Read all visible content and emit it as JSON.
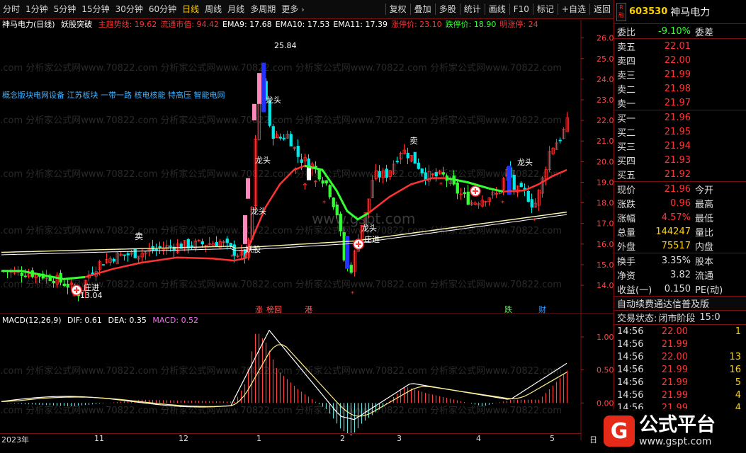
{
  "toolbar": {
    "left_items": [
      "分时",
      "1分钟",
      "5分钟",
      "15分钟",
      "30分钟",
      "60分钟",
      "日线",
      "周线",
      "月线",
      "多周期",
      "更多"
    ],
    "active": "日线",
    "right_items": [
      "复权",
      "叠加",
      "多股",
      "统计",
      "画线",
      "F10",
      "标记",
      "+自选",
      "返回"
    ]
  },
  "legend": {
    "stock": "神马电力(日线)",
    "indicator": "妖股突破",
    "items": [
      {
        "label": "主趋势线: 19.62",
        "color": "#ff3333"
      },
      {
        "label": "流通市值: 94.42",
        "color": "#ff3333"
      },
      {
        "label": "EMA9: 17.68",
        "color": "#ffffff"
      },
      {
        "label": "EMA10: 17.53",
        "color": "#ffffff"
      },
      {
        "label": "EMA11: 17.39",
        "color": "#ffffff"
      },
      {
        "label": "涨停价: 23.10",
        "color": "#ff3333"
      },
      {
        "label": "跌停价: 18.90",
        "color": "#33ff33"
      },
      {
        "label": "明涨停: 24",
        "color": "#ff3333"
      }
    ]
  },
  "concept": "概念版块电网设备 江苏板块 一带一路 核电核能 特高压 智能电网",
  "watermark": "2.com 分析家公式网www.70822.com 分析家公式网www.70822.com 分析家公式网www.70822.com 分析家公式网www.70822.com",
  "watermark2": "www.gspt.com",
  "main_yaxis": [
    "26.00",
    "25.00",
    "24.00",
    "23.00",
    "22.00",
    "21.00",
    "20.00",
    "19.00",
    "18.00",
    "17.00",
    "16.00",
    "15.00",
    "14.00"
  ],
  "macd_yaxis": [
    "1.00",
    "0.50",
    "0.00"
  ],
  "macd_legend": {
    "name": "MACD(12,26,9)",
    "dif": "DIF: 0.61",
    "dea": "DEA: 0.35",
    "macd": "MACD: 0.52"
  },
  "annotations": {
    "high": "25.84",
    "low": "13.04",
    "longtou": "龙头",
    "sell": "卖",
    "yaogu": "妖股",
    "zhuangjin": "庄进",
    "flags": [
      "涨",
      "榜回",
      "港",
      "跌",
      "财"
    ]
  },
  "x_labels": [
    "2023年",
    "11",
    "12",
    "1",
    "2",
    "3",
    "4",
    "5",
    "日"
  ],
  "right_panel": {
    "badge": "R\n融",
    "code": "603530",
    "name": "神马电力",
    "weibi": {
      "label": "委比",
      "value": "-9.10%",
      "label2": "委差"
    },
    "sell_rows": [
      {
        "label": "卖五",
        "price": "22.01"
      },
      {
        "label": "卖四",
        "price": "22.00"
      },
      {
        "label": "卖三",
        "price": "21.99"
      },
      {
        "label": "卖二",
        "price": "21.98"
      },
      {
        "label": "卖一",
        "price": "21.97"
      }
    ],
    "buy_rows": [
      {
        "label": "买一",
        "price": "21.96"
      },
      {
        "label": "买二",
        "price": "21.95"
      },
      {
        "label": "买三",
        "price": "21.94"
      },
      {
        "label": "买四",
        "price": "21.93"
      },
      {
        "label": "买五",
        "price": "21.92"
      }
    ],
    "quote_rows": [
      {
        "label": "现价",
        "value": "21.96",
        "label2": "今开",
        "color": "#ff3333"
      },
      {
        "label": "涨跌",
        "value": "0.96",
        "label2": "最高",
        "color": "#ff3333"
      },
      {
        "label": "涨幅",
        "value": "4.57%",
        "label2": "最低",
        "color": "#ff3333"
      },
      {
        "label": "总量",
        "value": "144247",
        "label2": "量比",
        "color": "#ffd000"
      },
      {
        "label": "外盘",
        "value": "75517",
        "label2": "内盘",
        "color": "#ffd000"
      }
    ],
    "extra_rows": [
      {
        "label": "换手",
        "value": "3.35%",
        "label2": "股本",
        "color": "#ddd"
      },
      {
        "label": "净资",
        "value": "3.82",
        "label2": "流通",
        "color": "#ddd"
      },
      {
        "label": "收益(一)",
        "value": "0.150",
        "label2": "PE(动)",
        "color": "#ddd"
      }
    ],
    "ad": "自动续费通达信普及版",
    "status_label": "交易状态:",
    "status_value": "闭市阶段",
    "status_time": "15:0",
    "ticks": [
      {
        "time": "14:56",
        "price": "22.00",
        "vol": "1"
      },
      {
        "time": "14:56",
        "price": "21.99",
        "vol": ""
      },
      {
        "time": "14:56",
        "price": "22.00",
        "vol": "13"
      },
      {
        "time": "14:56",
        "price": "21.99",
        "vol": "16"
      },
      {
        "time": "14:56",
        "price": "21.99",
        "vol": "5"
      },
      {
        "time": "14:56",
        "price": "21.99",
        "vol": "4"
      },
      {
        "time": "14:56",
        "price": "21.99",
        "vol": "4"
      }
    ]
  },
  "logo": {
    "title": "公式平台",
    "url": "www.gspt.com"
  },
  "colors": {
    "up": "#ff3333",
    "down": "#33ff33",
    "accent": "#ffd000",
    "border": "#7a1010"
  }
}
